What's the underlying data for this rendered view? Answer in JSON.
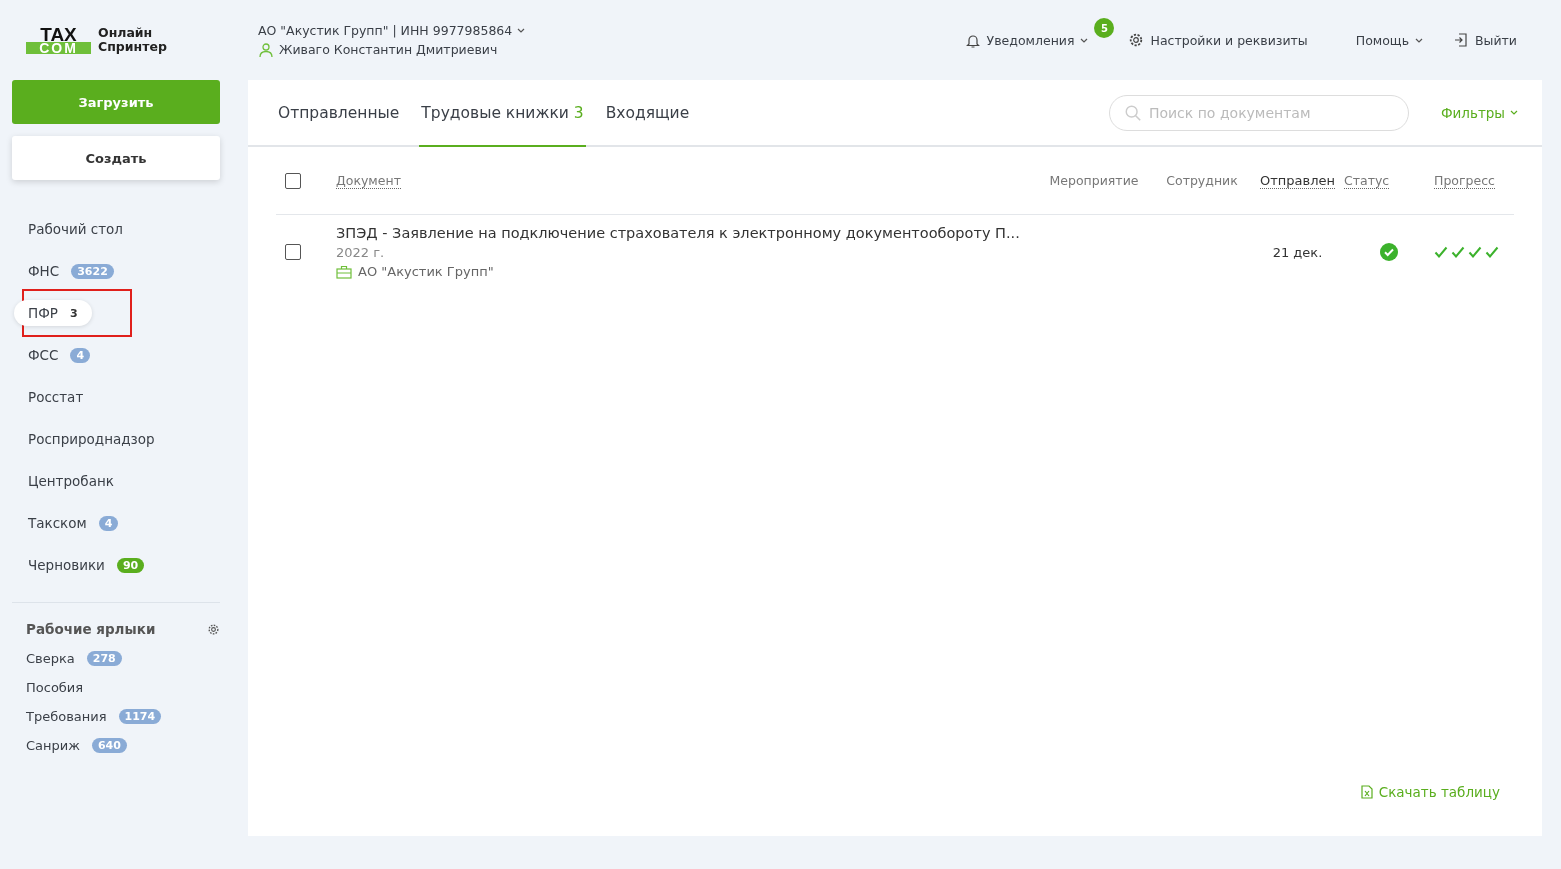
{
  "logo": {
    "top": "TAX",
    "bottom": "COM",
    "line1": "Онлайн",
    "line2": "Спринтер"
  },
  "company": {
    "name": "АО \"Акустик Групп\" | ИНН 9977985864",
    "user": "Живаго Константин Дмитриевич"
  },
  "top_nav": [
    {
      "kind": "bell",
      "label": "Уведомления",
      "dropdown": true,
      "badge": "5"
    },
    {
      "kind": "gear",
      "label": "Настройки и реквизиты",
      "dropdown": false
    },
    {
      "kind": "none",
      "label": "Помощь",
      "dropdown": true
    },
    {
      "kind": "exit",
      "label": "Выйти",
      "dropdown": false
    }
  ],
  "upload_button": "Загрузить",
  "create_button": "Создать",
  "sidebar": {
    "items": [
      {
        "label": "Рабочий стол",
        "selected": false,
        "highlighted": false
      },
      {
        "label": "ФНС",
        "badge": "3622",
        "color": "#8aabd6",
        "selected": false,
        "highlighted": false
      },
      {
        "label": "ПФР",
        "badge": "3",
        "selected": true,
        "highlighted": true
      },
      {
        "label": "ФСС",
        "badge": "4",
        "color": "#8aabd6",
        "selected": false,
        "highlighted": false
      },
      {
        "label": "Росстат",
        "selected": false,
        "highlighted": false
      },
      {
        "label": "Росприроднадзор",
        "selected": false,
        "highlighted": false
      },
      {
        "label": "Центробанк",
        "selected": false,
        "highlighted": false
      },
      {
        "label": "Такском",
        "badge": "4",
        "color": "#8aabd6",
        "selected": false,
        "highlighted": false
      },
      {
        "label": "Черновики",
        "badge": "90",
        "color": "#5aae1e",
        "selected": false,
        "highlighted": false
      }
    ],
    "shortcuts_title": "Рабочие ярлыки",
    "shortcuts": [
      {
        "label": "Сверка",
        "badge": "278",
        "color": "#8aabd6"
      },
      {
        "label": "Пособия"
      },
      {
        "label": "Требования",
        "badge": "1174",
        "color": "#8aabd6"
      },
      {
        "label": "Санриж",
        "badge": "640",
        "color": "#8aabd6"
      }
    ]
  },
  "tabs": [
    {
      "label": "Отправленные",
      "selected": false
    },
    {
      "label": "Трудовые книжки",
      "count": "3",
      "selected": true
    },
    {
      "label": "Входящие",
      "selected": false
    }
  ],
  "search": {
    "placeholder": "Поиск по документам"
  },
  "filters": "Фильтры",
  "table": {
    "columns": [
      {
        "label": "Документ",
        "sortable": true
      },
      {
        "label": "Мероприятие",
        "sortable": false
      },
      {
        "label": "Сотрудник",
        "sortable": false
      },
      {
        "label": "Отправлен",
        "sortable": true
      },
      {
        "label": "Статус",
        "sortable": true
      },
      {
        "label": "Прогресс",
        "sortable": true
      }
    ],
    "select_all": false,
    "rows": [
      {
        "checked": false,
        "title": "ЗПЭД - Заявление на подключение страхователя к электронному документообороту П...",
        "year": "2022 г.",
        "org": "АО \"Акустик Групп\"",
        "sent": "21 дек.",
        "status_ok": true,
        "progress": [
          {
            "done": true
          },
          {
            "done": true
          },
          {
            "done": true
          },
          {
            "done": true
          }
        ]
      }
    ]
  },
  "download": "Скачать таблицу"
}
